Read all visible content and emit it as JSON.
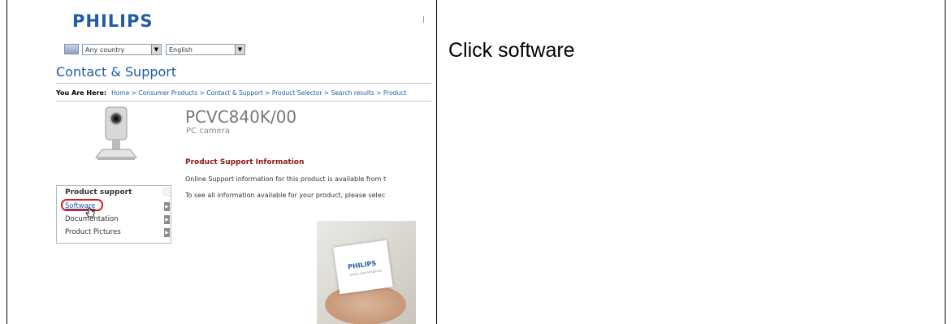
{
  "instruction": "Click software",
  "brand": "PHILIPS",
  "locale": {
    "country": "Any country",
    "language": "English"
  },
  "section_title": "Contact & Support",
  "breadcrumb": {
    "label": "You Are Here:",
    "path": "Home > Consumer Products > Contact & Support > Product Selector > Search results > Product"
  },
  "product": {
    "model": "PCVC840K/00",
    "type": "PC camera"
  },
  "support_info": {
    "title": "Product Support Information",
    "line1": "Online Support information for this product is available from t",
    "line2": "To see all information available for your product, please selec"
  },
  "product_support": {
    "header": "Product support",
    "items": [
      "Software",
      "Documentation",
      "Product Pictures"
    ]
  },
  "promo": {
    "logo": "PHILIPS",
    "tagline": "sense and simplicity"
  },
  "colors": {
    "brand_blue": "#1f5ca8",
    "title_red": "#8b1414",
    "highlight_red": "#d42020"
  }
}
